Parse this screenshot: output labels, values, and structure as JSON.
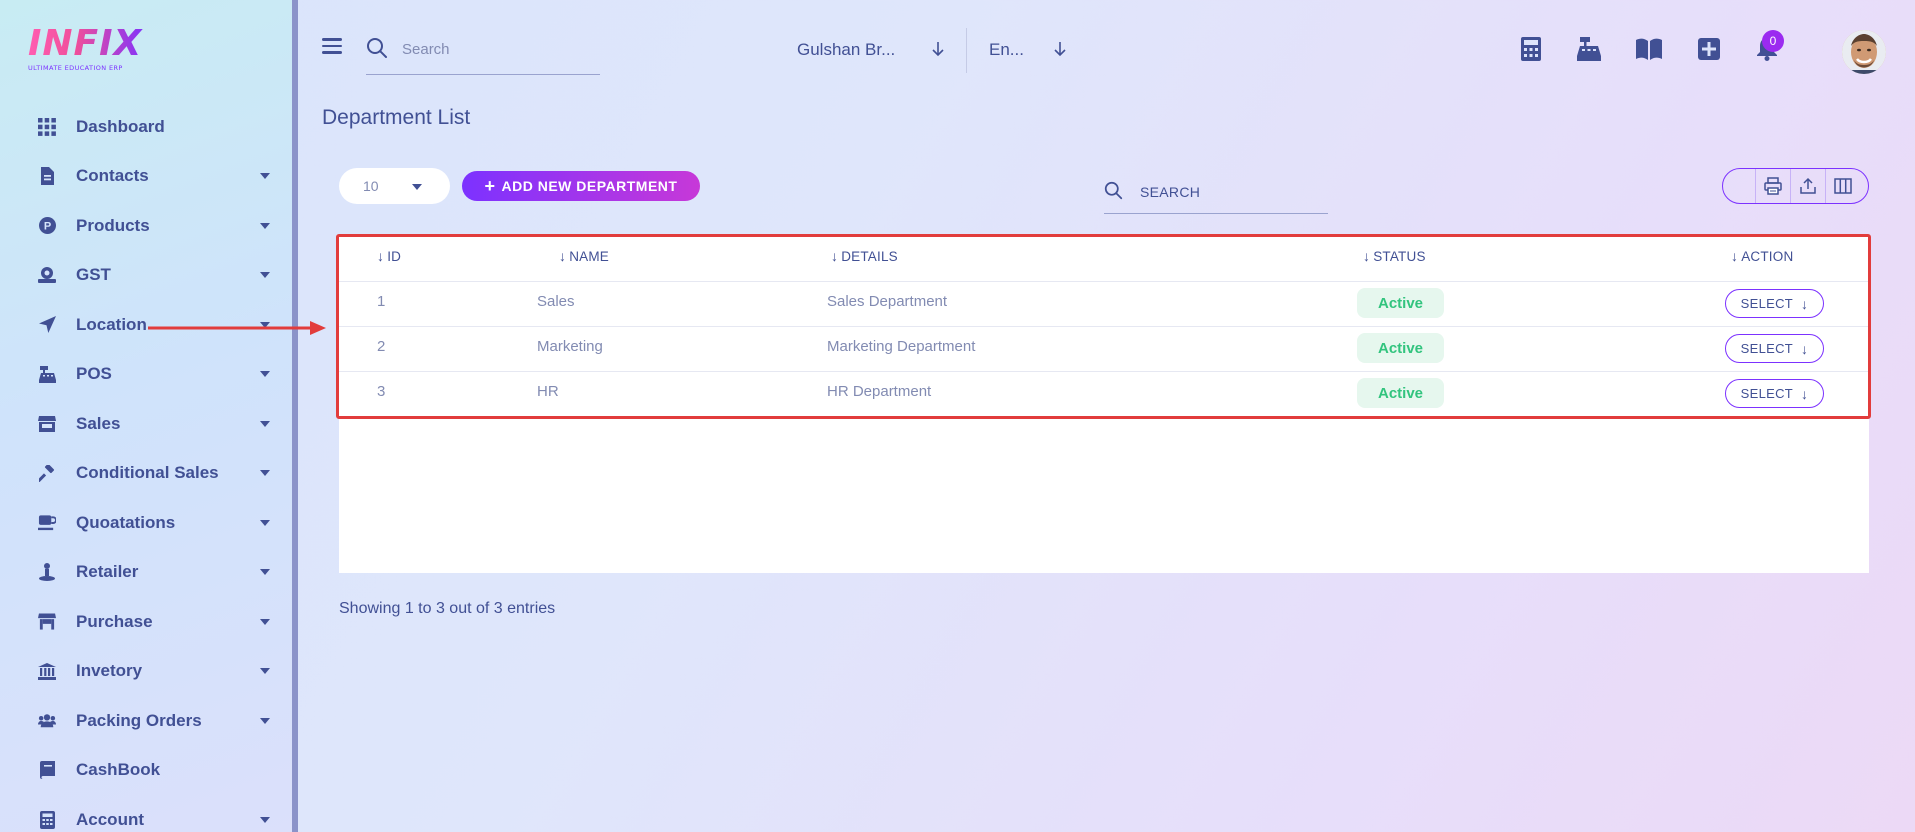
{
  "brand": {
    "logo_text": "INFIX",
    "logo_subtitle": "ULTIMATE EDUCATION ERP"
  },
  "sidebar": {
    "items": [
      {
        "label": "Dashboard",
        "icon": "grid-icon",
        "has_submenu": false
      },
      {
        "label": "Contacts",
        "icon": "contacts-icon",
        "has_submenu": true
      },
      {
        "label": "Products",
        "icon": "products-icon",
        "has_submenu": true
      },
      {
        "label": "GST",
        "icon": "gst-icon",
        "has_submenu": true
      },
      {
        "label": "Location",
        "icon": "location-arrow-icon",
        "has_submenu": true
      },
      {
        "label": "POS",
        "icon": "cash-register-icon",
        "has_submenu": true
      },
      {
        "label": "Sales",
        "icon": "store-icon",
        "has_submenu": true
      },
      {
        "label": "Conditional Sales",
        "icon": "gavel-icon",
        "has_submenu": true
      },
      {
        "label": "Quoatations",
        "icon": "coffee-icon",
        "has_submenu": true
      },
      {
        "label": "Retailer",
        "icon": "retailer-icon",
        "has_submenu": true
      },
      {
        "label": "Purchase",
        "icon": "shop-icon",
        "has_submenu": true
      },
      {
        "label": "Invetory",
        "icon": "bank-icon",
        "has_submenu": true
      },
      {
        "label": "Packing Orders",
        "icon": "users-icon",
        "has_submenu": true
      },
      {
        "label": "CashBook",
        "icon": "book-icon",
        "has_submenu": false
      },
      {
        "label": "Account",
        "icon": "calculator-icon",
        "has_submenu": true
      }
    ]
  },
  "header": {
    "search_placeholder": "Search",
    "branch_select": "Gulshan Br...",
    "language_select": "En...",
    "notification_count": "0",
    "icons": [
      "calculator-icon",
      "cash-register-icon",
      "book-open-icon",
      "plus-square-icon",
      "bell-icon"
    ]
  },
  "page": {
    "title": "Department List",
    "page_size": "10",
    "add_button": "ADD NEW DEPARTMENT",
    "table_search_placeholder": "SEARCH",
    "tools": [
      "print-icon",
      "export-icon",
      "columns-icon"
    ]
  },
  "table": {
    "columns": [
      "ID",
      "NAME",
      "DETAILS",
      "STATUS",
      "ACTION"
    ],
    "rows": [
      {
        "id": "1",
        "name": "Sales",
        "details": "Sales Department",
        "status": "Active",
        "action": "SELECT"
      },
      {
        "id": "2",
        "name": "Marketing",
        "details": "Marketing Department",
        "status": "Active",
        "action": "SELECT"
      },
      {
        "id": "3",
        "name": "HR",
        "details": "HR Department",
        "status": "Active",
        "action": "SELECT"
      }
    ]
  },
  "footer": {
    "showing": "Showing 1 to 3 out of 3 entries"
  },
  "colors": {
    "primary": "#7c32ff",
    "accent_pink": "#c738d8",
    "text": "#415094",
    "muted": "#828bb2",
    "status_active": "#32c47e",
    "annotation_red": "#e23c3c"
  }
}
